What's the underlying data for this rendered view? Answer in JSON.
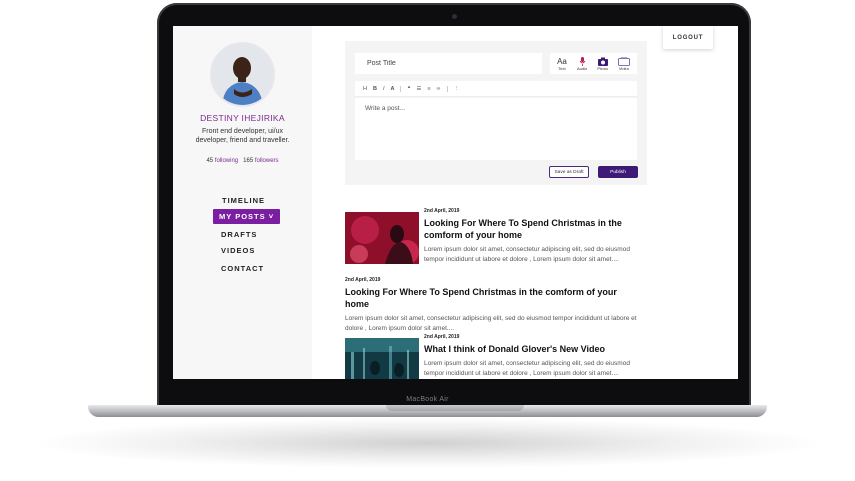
{
  "device": {
    "brand": "MacBook Air"
  },
  "colors": {
    "accent": "#7b1fa2",
    "publish": "#3d1a78",
    "name": "#7b2a8e"
  },
  "profile": {
    "name": "DESTINY IHEJIRIKA",
    "bio": "Front end developer, ui/ux developer, friend and traveller.",
    "following_count": "45",
    "following_label": "following",
    "followers_count": "165",
    "followers_label": "followers"
  },
  "nav": {
    "timeline": "TIMELINE",
    "my_posts": "MY POSTS",
    "drafts": "DRAFTS",
    "videos": "VIDEOS",
    "contact": "CONTACT"
  },
  "header": {
    "logout": "LOGOUT"
  },
  "editor": {
    "title_placeholder": "Post Title",
    "types": [
      {
        "label": "Text",
        "icon": "text-type-icon"
      },
      {
        "label": "Audio",
        "icon": "microphone-icon"
      },
      {
        "label": "Photo",
        "icon": "camera-icon"
      },
      {
        "label": "Video",
        "icon": "video-icon"
      }
    ],
    "type_glyph_text": "Aa",
    "toolbar": {
      "h": "H",
      "b": "B",
      "i": "I",
      "a": "A"
    },
    "body_placeholder": "Write a post...",
    "save_draft": "Save as Draft",
    "publish": "Publish"
  },
  "posts": [
    {
      "date": "2nd April, 2019",
      "title": "Looking For Where To Spend Christmas in the comform of your home",
      "excerpt": "Lorem ipsum dolor sit amet, consectetur adipiscing elit, sed do eiusmod tempor incididunt ut labore et dolore , Lorem ipsum dolor sit amet....",
      "thumbnail": "red-christmas-photo"
    },
    {
      "date": "2nd April, 2019",
      "title": "Looking For Where To Spend Christmas in the comform of your home",
      "excerpt": "Lorem ipsum dolor sit amet, consectetur adipiscing elit, sed do eiusmod tempor incididunt ut labore et dolore , Lorem ipsum dolor sit amet...."
    },
    {
      "date": "2nd April, 2019",
      "title": "What I think of Donald Glover's New Video",
      "excerpt": "Lorem ipsum dolor sit amet, consectetur adipiscing elit, sed do eiusmod tempor incididunt ut labore et dolore , Lorem ipsum dolor sit amet....",
      "thumbnail": "teal-stage-photo"
    }
  ]
}
